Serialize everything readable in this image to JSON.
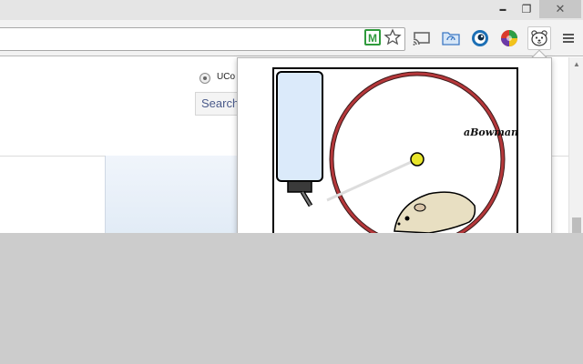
{
  "window": {
    "minimize_icon": "minimize-icon",
    "restore_icon": "restore-icon",
    "close_icon": "close-icon",
    "minimize_glyph": "▬",
    "restore_glyph": "❐",
    "close_glyph": "✕"
  },
  "toolbar": {
    "extensions": [
      {
        "name": "shield-m-extension-icon",
        "label": "M"
      },
      {
        "name": "bookmark-star-icon"
      },
      {
        "name": "cast-icon"
      },
      {
        "name": "folder-extension-icon"
      },
      {
        "name": "eye-extension-icon"
      },
      {
        "name": "colorful-ball-extension-icon"
      },
      {
        "name": "hamster-extension-icon"
      },
      {
        "name": "menu-icon"
      }
    ]
  },
  "page": {
    "radio_label": "UCo",
    "search_button": "Search"
  },
  "popup": {
    "signature": "aBowman",
    "colors": {
      "wheel": "#b5373a",
      "bottle": "#dbeafa",
      "hub": "#e8e52a",
      "hamster": "#e8dfc2"
    }
  }
}
